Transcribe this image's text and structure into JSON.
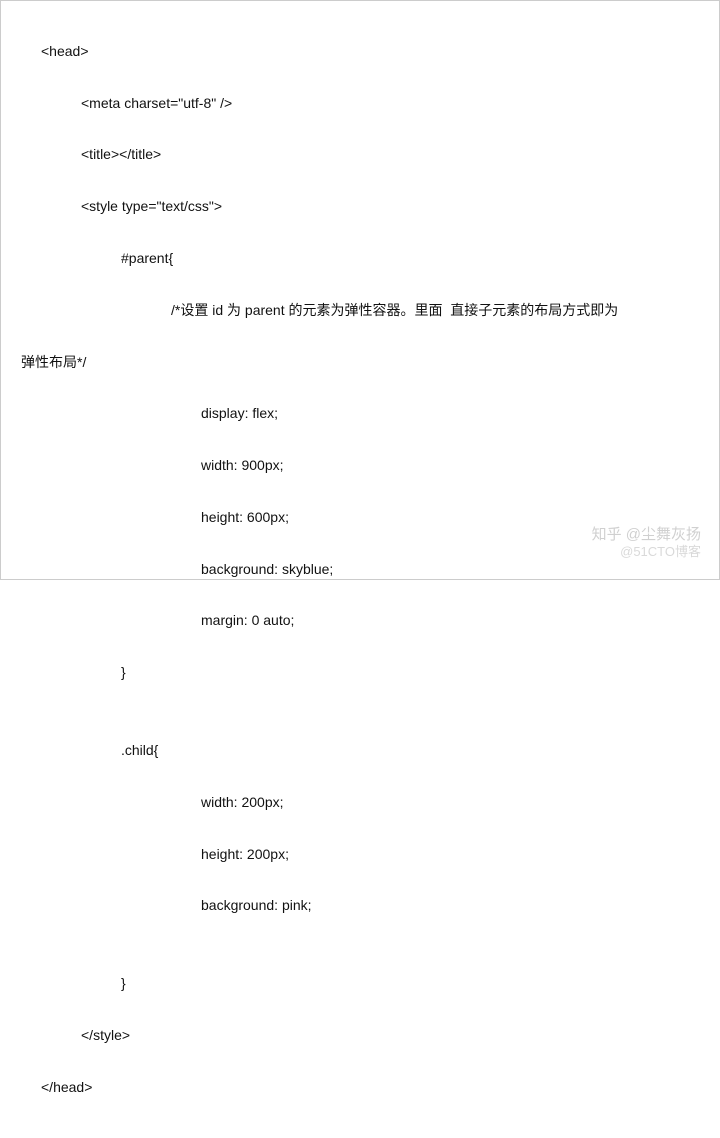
{
  "code": {
    "head_open": "<head>",
    "meta": "<meta charset=\"utf-8\" />",
    "title": "<title></title>",
    "style_open": "<style type=\"text/css\">",
    "parent_sel": "#parent{",
    "comment_l1": "/*设置 id 为 parent 的元素为弹性容器。里面  直接子元素的布局方式即为",
    "comment_l2": "弹性布局*/",
    "p_display": "display: flex;",
    "p_width": "width: 900px;",
    "p_height": "height: 600px;",
    "p_bg": "background: skyblue;",
    "p_margin": "margin: 0 auto;",
    "close_parent": "}",
    "blank": "",
    "child_sel": ".child{",
    "c_width": "width: 200px;",
    "c_height": "height: 200px;",
    "c_bg": "background: pink;",
    "close_child": "}",
    "style_close": "</style>",
    "head_close": "</head>"
  },
  "watermark": {
    "line1": "知乎 @尘舞灰扬",
    "line2": "@51CTO博客"
  }
}
